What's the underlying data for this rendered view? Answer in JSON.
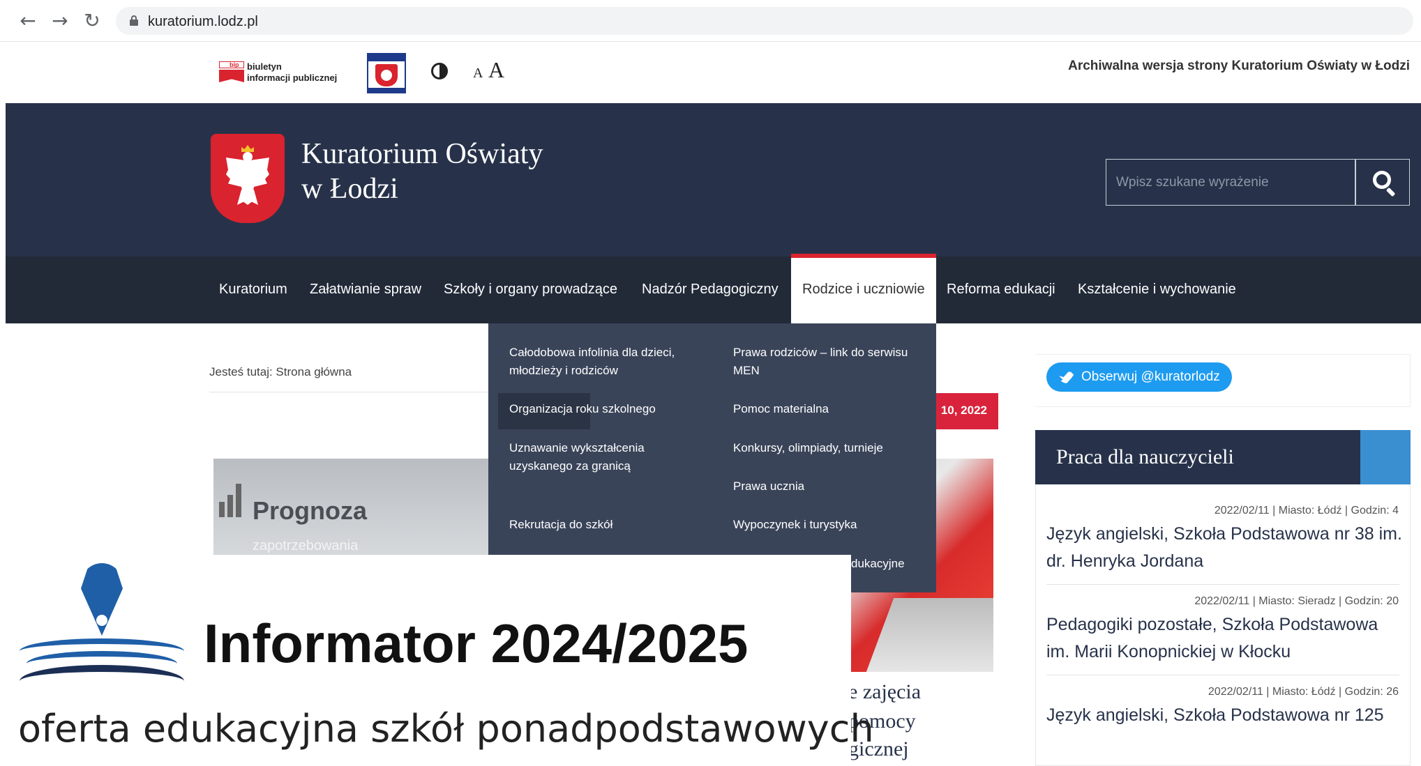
{
  "browser": {
    "url": "kuratorium.lodz.pl",
    "back_icon": "←",
    "forward_icon": "→",
    "reload_icon": "↻"
  },
  "utility": {
    "bip_line1": "biuletyn",
    "bip_line2": "informacji publicznej",
    "font_small": "A",
    "font_large": "A",
    "archive_text": "Archiwalna wersja strony Kuratorium Oświaty w Łodzi"
  },
  "header": {
    "title_line1": "Kuratorium Oświaty",
    "title_line2": "w Łodzi",
    "search_placeholder": "Wpisz szukane wyrażenie"
  },
  "nav": {
    "items": [
      "Kuratorium",
      "Załatwianie spraw",
      "Szkoły i organy prowadzące",
      "Nadzór Pedagogiczny",
      "Rodzice i uczniowie",
      "Reforma edukacji",
      "Kształcenie i wychowanie"
    ],
    "active_index": 4
  },
  "dropdown": {
    "items": [
      "Całodobowa infolinia dla dzieci, młodzieży i rodziców",
      "Prawa rodziców – link do serwisu MEN",
      "Organizacja roku szkolnego",
      "Pomoc materialna",
      "Uznawanie wykształcenia uzyskanego za granicą",
      "Konkursy, olimpiady, turnieje",
      "Prawa ucznia",
      "Rekrutacja do szkół",
      "Wypoczynek i turystyka",
      "dukacyjne"
    ]
  },
  "content": {
    "breadcrumb": "Jesteś tutaj: Strona główna",
    "date_badge": "10, 2022",
    "img_left_title": "Prognoza",
    "img_left_sub": "zapotrzebowania",
    "news_lines": [
      "e zajęcia",
      "pomocy",
      "gicznej"
    ]
  },
  "sidebar": {
    "twitter_label": "Obserwuj @kuratorlodz",
    "jobs_heading": "Praca dla nauczycieli",
    "jobs": [
      {
        "meta": "2022/02/11 | Miasto: Łódź | Godzin: 4",
        "title": "Język angielski, Szkoła Podstawowa nr 38 im. dr. Henryka Jordana"
      },
      {
        "meta": "2022/02/11 | Miasto: Sieradz | Godzin: 20",
        "title": "Pedagogiki pozostałe, Szkoła Podstawowa im. Marii Konopnickiej w Kłocku"
      },
      {
        "meta": "2022/02/11 | Miasto: Łódź | Godzin: 26",
        "title": "Język angielski, Szkoła Podstawowa nr 125"
      }
    ]
  },
  "informator": {
    "title": "Informator 2024/2025",
    "subtitle": "oferta edukacyjna szkół ponadpodstawowych"
  }
}
